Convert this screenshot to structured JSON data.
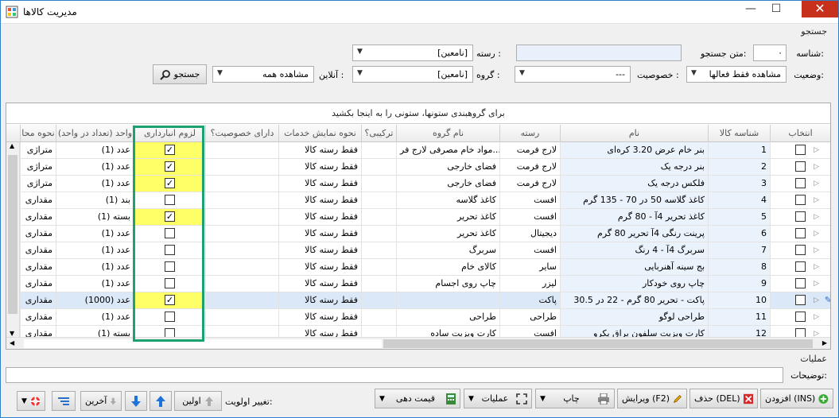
{
  "window": {
    "title": "مدیریت کالاها",
    "minimize": "—",
    "maximize": "☐",
    "close": "✕"
  },
  "search": {
    "section_title": "جستجو",
    "id_label": "شناسه:",
    "id_value": "٠",
    "text_label": "متن جستجو:",
    "text_value": "",
    "category_label": "رسته :",
    "category_value": "[نامعین]",
    "status_label": "وضعیت:",
    "status_value": "مشاهده فقط فعالها",
    "feature_label": "خصوصیت :",
    "feature_value": "---",
    "group_label": "گروه :",
    "group_value": "[نامعین]",
    "online_label": "آنلاین :",
    "online_value": "مشاهده همه",
    "search_button": "جستجو"
  },
  "grid": {
    "group_prompt": "برای گروهبندی ستونها، ستونی را به اینجا بکشید",
    "headers": {
      "select": "انتخاب",
      "code": "شناسه کالا",
      "name": "نام",
      "category": "رسته",
      "group": "نام گروه",
      "composite": "ترکیبی؟",
      "service": "نحوه نمایش خدمات",
      "has_feature": "دارای خصوصیت؟",
      "needs_inventory": "لزوم انبارداری",
      "unit": "واحد (تعداد در واحد)",
      "calc": "نحوه محا"
    },
    "rows": [
      {
        "code": "1",
        "name": "بنر خام عرض 3.20 کره‌ای",
        "category": "لارج فرمت",
        "group": "مواد خام مصرفی لارج فر...",
        "service": "فقط رسته کالا",
        "inv": true,
        "unit": "عدد (1)",
        "calc": "متراژی"
      },
      {
        "code": "2",
        "name": "بنر درجه یک",
        "category": "لارج فرمت",
        "group": "فضای خارجی",
        "service": "فقط رسته کالا",
        "inv": true,
        "unit": "عدد (1)",
        "calc": "متراژی"
      },
      {
        "code": "3",
        "name": "فلکس درجه یک",
        "category": "لارج فرمت",
        "group": "فضای خارجی",
        "service": "فقط رسته کالا",
        "inv": true,
        "unit": "عدد (1)",
        "calc": "متراژی"
      },
      {
        "code": "4",
        "name": "کاغذ گلاسه 50 در 70 - 135 گرم",
        "category": "افست",
        "group": "کاغذ گلاسه",
        "service": "فقط رسته کالا",
        "inv": false,
        "unit": "بند (1)",
        "calc": "مقداری"
      },
      {
        "code": "5",
        "name": "کاغذ تحریر 4آ - 80 گرم",
        "category": "افست",
        "group": "کاغذ تحریر",
        "service": "فقط رسته کالا",
        "inv": true,
        "unit": "بسته (1)",
        "calc": "مقداری"
      },
      {
        "code": "6",
        "name": "پرینت رنگی 4آ تحریر 80 گرم",
        "category": "دیجیتال",
        "group": "کاغذ تحریر",
        "service": "فقط رسته کالا",
        "inv": false,
        "unit": "عدد (1)",
        "calc": "مقداری"
      },
      {
        "code": "7",
        "name": "سربرگ 4آ - 4 رنگ",
        "category": "افست",
        "group": "سربرگ",
        "service": "فقط رسته کالا",
        "inv": false,
        "unit": "عدد (1)",
        "calc": "مقداری"
      },
      {
        "code": "8",
        "name": "بج سینه آهنربایی",
        "category": "سایر",
        "group": "کالای خام",
        "service": "فقط رسته کالا",
        "inv": false,
        "unit": "عدد (1)",
        "calc": "مقداری"
      },
      {
        "code": "9",
        "name": "چاپ روی خودکار",
        "category": "لیزر",
        "group": "چاپ روی اجسام",
        "service": "فقط رسته کالا",
        "inv": false,
        "unit": "عدد (1)",
        "calc": "مقداری"
      },
      {
        "code": "10",
        "name": "پاکت - تحریر 80 گرم - 22 در 30.5",
        "category": "پاکت",
        "group": "",
        "service": "فقط رسته کالا",
        "inv": true,
        "unit": "عدد (1000)",
        "calc": "مقداری"
      },
      {
        "code": "11",
        "name": "طراحی لوگو",
        "category": "طراحی",
        "group": "طراحی",
        "service": "فقط رسته کالا",
        "inv": false,
        "unit": "عدد (1)",
        "calc": "مقداری"
      },
      {
        "code": "12",
        "name": "کارت ویزیت سلفون براق یکرو",
        "category": "افست",
        "group": "کارت ویزیت ساده",
        "service": "فقط رسته کالا",
        "inv": false,
        "unit": "بسته (1)",
        "calc": "مقداری"
      }
    ]
  },
  "operations": {
    "section_title": "عملیات",
    "notes_label": "توضیحات:",
    "add": "افزودن (INS)",
    "delete": "حذف (DEL)",
    "edit": "ویرایش (F2)",
    "print": "چاپ",
    "ops": "عملیات",
    "pricing": "قیمت دهی",
    "priority_label": "تغییر اولویت:",
    "first": "اولین",
    "last": "آخرین"
  },
  "colors": {
    "highlight_border": "#1aa36e",
    "selected_cell": "#ffff66",
    "window_border": "#2f7fc9",
    "close_bg": "#c7311c"
  }
}
